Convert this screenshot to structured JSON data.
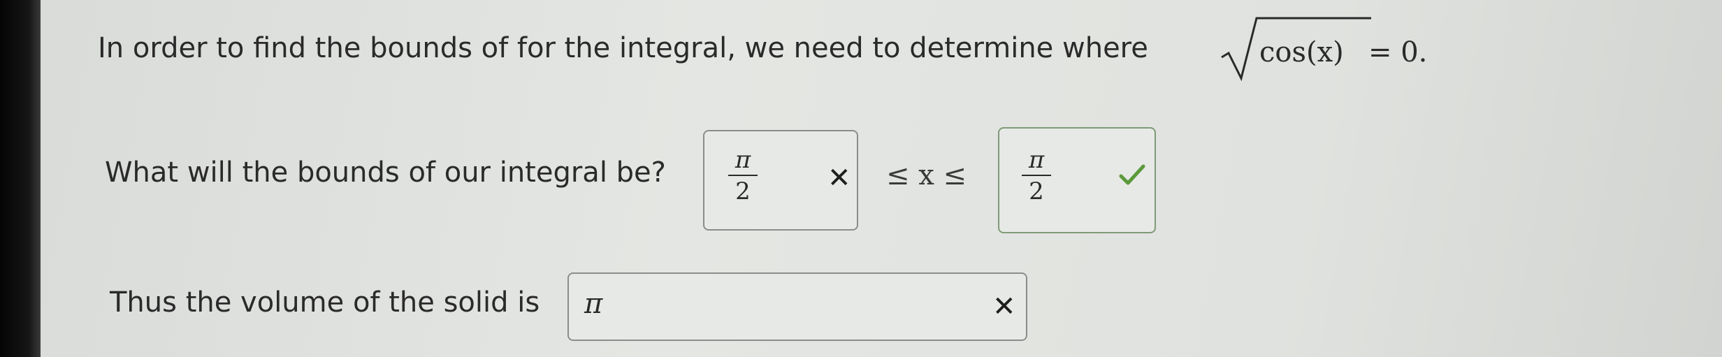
{
  "question": {
    "intro_text": "In order to find the bounds of for the integral, we need to determine where",
    "sqrt_expression": "cos(x)",
    "equation_suffix": "= 0.",
    "bounds_prompt": "What will the bounds of our integral be?",
    "lower_bound": {
      "numerator": "π",
      "denominator": "2",
      "status": "incorrect",
      "status_icon": "x-icon"
    },
    "inequality_text": "≤ x ≤",
    "upper_bound": {
      "numerator": "π",
      "denominator": "2",
      "status": "correct",
      "status_icon": "check-icon"
    },
    "volume_prompt": "Thus the volume of the solid is",
    "volume_answer": {
      "value": "π",
      "status": "incorrect",
      "status_icon": "x-icon"
    }
  },
  "colors": {
    "correct_check": "#5a9a3a",
    "incorrect_x": "#1e1e1e"
  }
}
